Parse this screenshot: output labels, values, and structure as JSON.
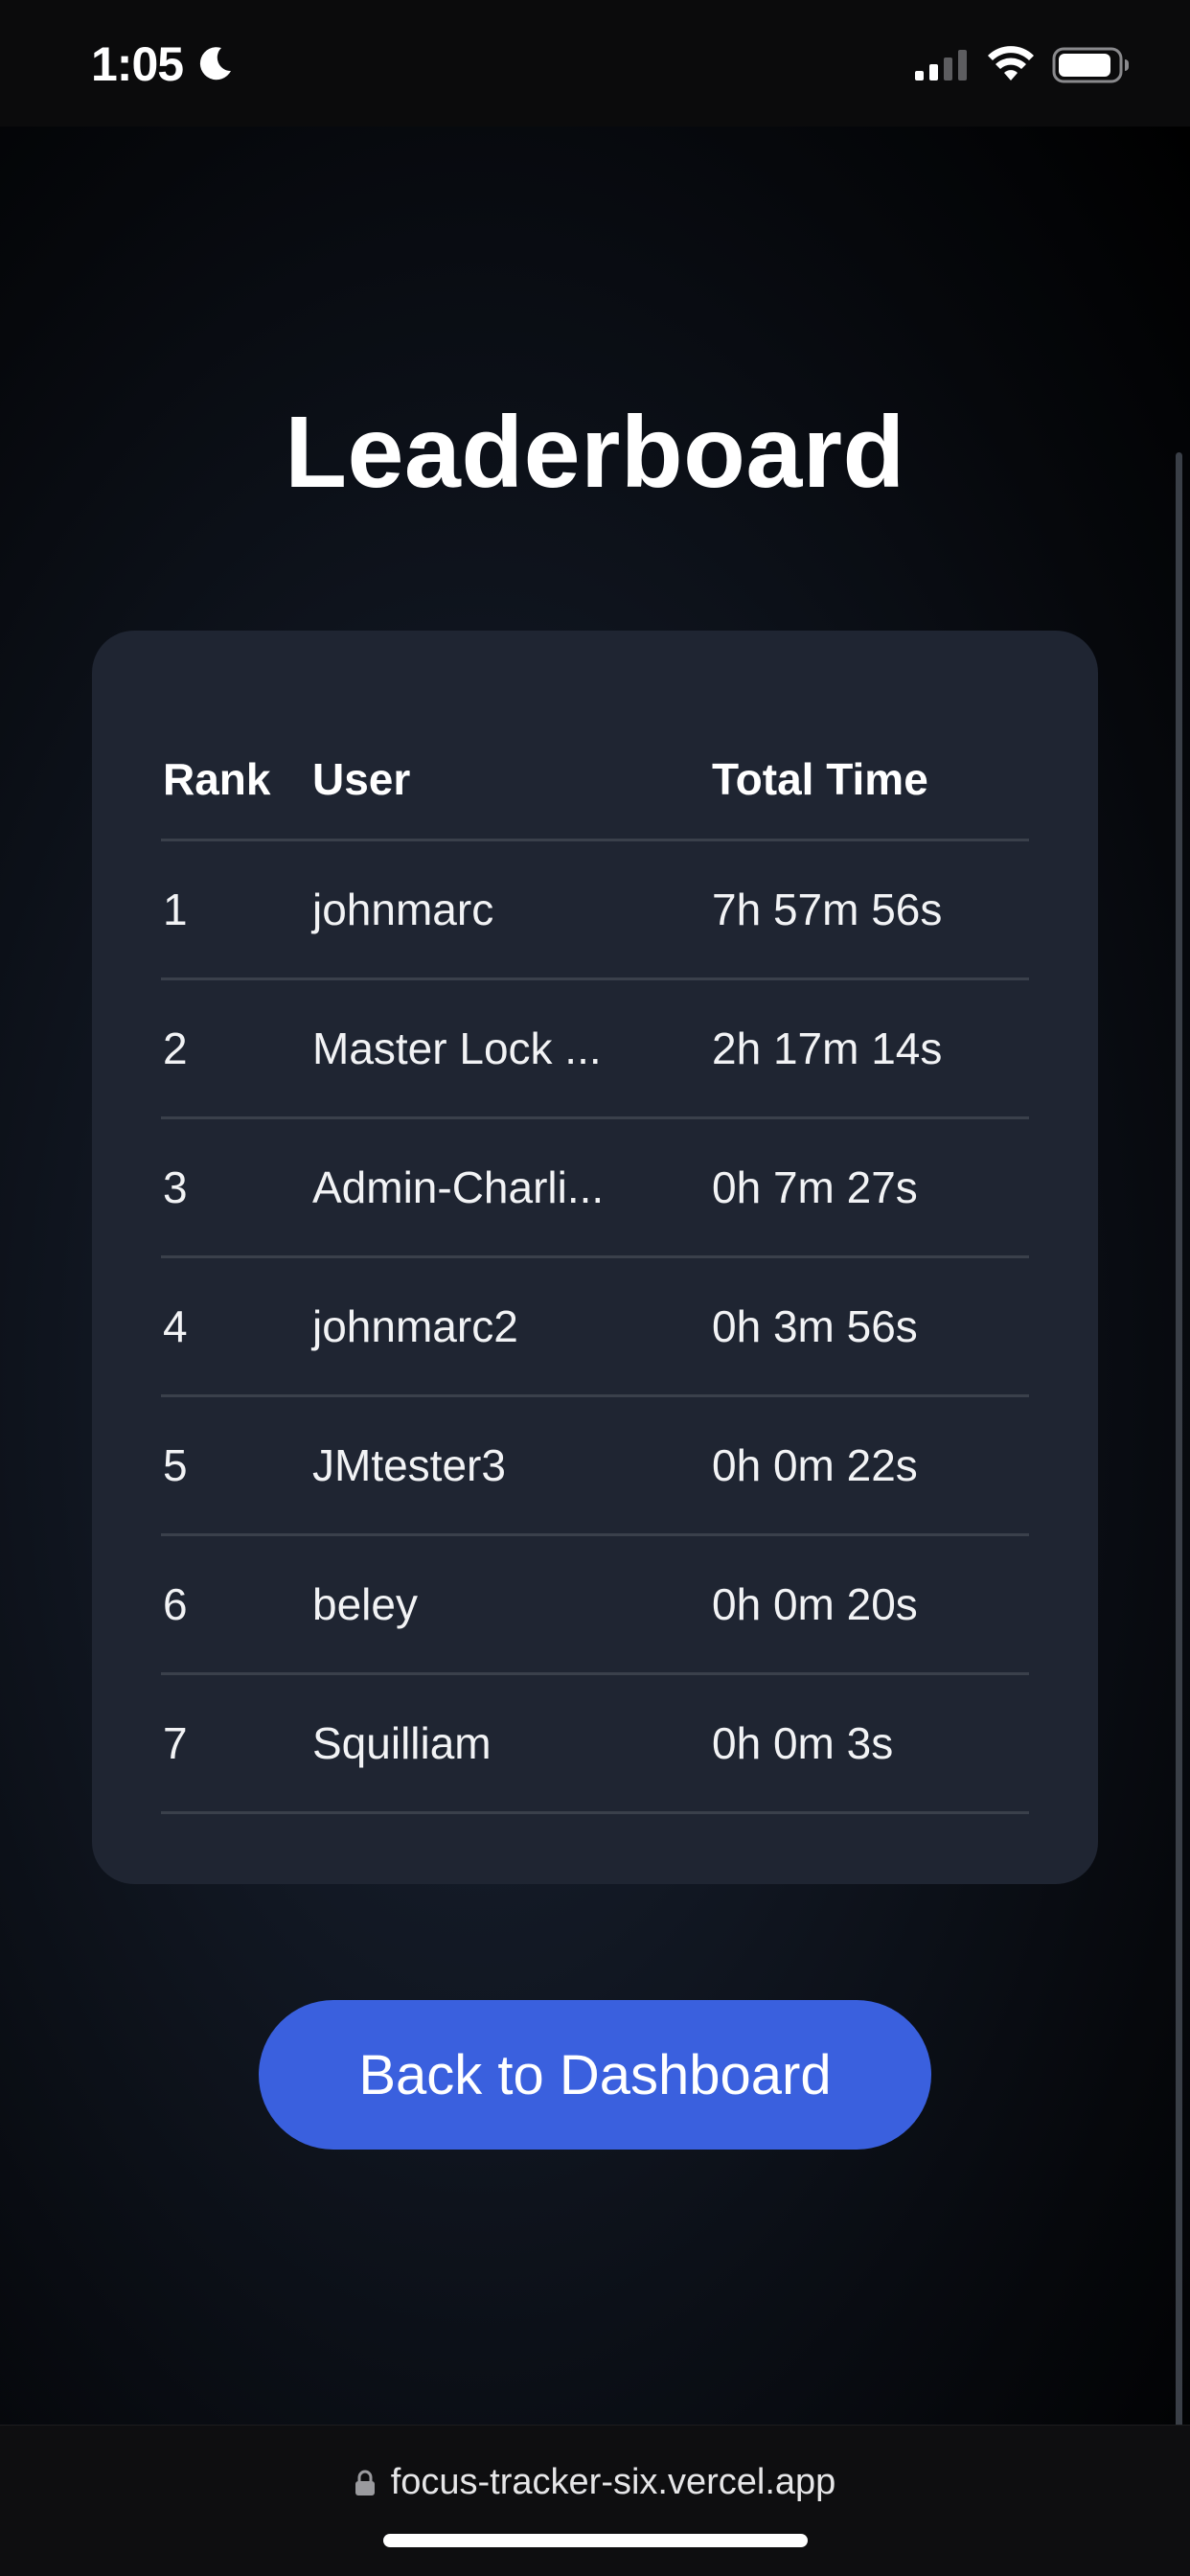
{
  "status_bar": {
    "time": "1:05",
    "icons": [
      "moon-icon",
      "signal-icon",
      "wifi-icon",
      "battery-icon"
    ]
  },
  "page": {
    "title": "Leaderboard"
  },
  "leaderboard": {
    "headers": {
      "rank": "Rank",
      "user": "User",
      "total_time": "Total Time"
    },
    "rows": [
      {
        "rank": "1",
        "user": "johnmarc",
        "time": "7h 57m 56s"
      },
      {
        "rank": "2",
        "user": "Master Lock ...",
        "time": "2h 17m 14s"
      },
      {
        "rank": "3",
        "user": "Admin-Charli...",
        "time": "0h 7m 27s"
      },
      {
        "rank": "4",
        "user": "johnmarc2",
        "time": "0h 3m 56s"
      },
      {
        "rank": "5",
        "user": "JMtester3",
        "time": "0h 0m 22s"
      },
      {
        "rank": "6",
        "user": "beley",
        "time": "0h 0m 20s"
      },
      {
        "rank": "7",
        "user": "Squilliam",
        "time": "0h 0m 3s"
      }
    ]
  },
  "actions": {
    "back_label": "Back to Dashboard"
  },
  "browser": {
    "url": "focus-tracker-six.vercel.app"
  },
  "colors": {
    "button": "#3a60de",
    "card": "#1f2532",
    "divider": "#3a404b"
  }
}
